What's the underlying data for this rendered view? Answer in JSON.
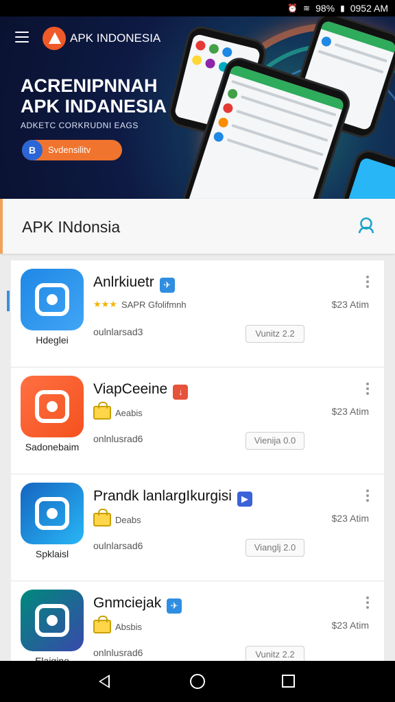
{
  "status_bar": {
    "battery": "98%",
    "time": "0952 AM"
  },
  "banner": {
    "brand": "APK INDONESIA",
    "headline_line1": "ACRENIPNNAH",
    "headline_line2": "APK INDANESIA",
    "subline": "ADKETC CORKRUDNI EAGS",
    "cta_badge": "B",
    "cta_label": "Svdensilitv"
  },
  "appbar": {
    "title": "APK INdonsia"
  },
  "apps": [
    {
      "name": "Anlrkiuetr",
      "sub": "Hdeglei",
      "rating_stars": "★★★",
      "meta": "SAPR Gfolifmnh",
      "price": "$23 Atim",
      "developer": "oulnlarsad3",
      "version": "Vunitz 2.2",
      "badge_color": "#2f8ee0",
      "badge_glyph": "✈",
      "icon_colors": [
        "#1e88e5",
        "#42a5f5"
      ]
    },
    {
      "name": "ViapCeeine",
      "sub": "Sadonebaim",
      "rating_stars": "",
      "meta": "Aeabis",
      "price": "$23 Atim",
      "developer": "onlnlusrad6",
      "version": "Vienija 0.0",
      "badge_color": "#e6523a",
      "badge_glyph": "↓",
      "icon_colors": [
        "#ff7043",
        "#f4511e"
      ]
    },
    {
      "name": "Prandk lanlargIkurgisi",
      "sub": "Spklaisl",
      "rating_stars": "",
      "meta": "Deabs",
      "price": "$23 Atim",
      "developer": "oulnlarsad6",
      "version": "Vianglj 2.0",
      "badge_color": "#3b62d8",
      "badge_glyph": "▶",
      "icon_colors": [
        "#1565c0",
        "#29b6f6"
      ]
    },
    {
      "name": "Gnmciejak",
      "sub": "Elaigino",
      "rating_stars": "",
      "meta": "Absbis",
      "price": "$23 Atim",
      "developer": "onlnlusrad6",
      "version": "Vunitz 2.2",
      "badge_color": "#2f8ee0",
      "badge_glyph": "✈",
      "icon_colors": [
        "#00897b",
        "#3949ab"
      ]
    }
  ],
  "colors": {
    "accent": "#f0742e",
    "search": "#1ba3c9"
  }
}
